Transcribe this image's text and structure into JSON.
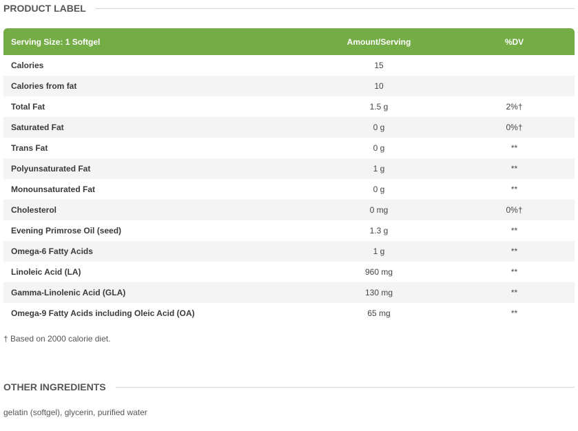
{
  "product_label": {
    "title": "PRODUCT LABEL",
    "headers": {
      "serving": "Serving Size: 1 Softgel",
      "amount": "Amount/Serving",
      "dv": "%DV"
    },
    "rows": [
      {
        "name": "Calories",
        "amount": "15",
        "dv": ""
      },
      {
        "name": "Calories from fat",
        "amount": "10",
        "dv": ""
      },
      {
        "name": "Total Fat",
        "amount": "1.5 g",
        "dv": "2%†"
      },
      {
        "name": "Saturated Fat",
        "amount": "0 g",
        "dv": "0%†"
      },
      {
        "name": "Trans Fat",
        "amount": "0 g",
        "dv": "**"
      },
      {
        "name": "Polyunsaturated Fat",
        "amount": "1 g",
        "dv": "**"
      },
      {
        "name": "Monounsaturated Fat",
        "amount": "0 g",
        "dv": "**"
      },
      {
        "name": "Cholesterol",
        "amount": "0 mg",
        "dv": "0%†"
      },
      {
        "name": "Evening Primrose Oil (seed)",
        "amount": "1.3 g",
        "dv": "**"
      },
      {
        "name": "Omega-6 Fatty Acids",
        "amount": "1 g",
        "dv": "**"
      },
      {
        "name": "Linoleic Acid (LA)",
        "amount": "960 mg",
        "dv": "**"
      },
      {
        "name": "Gamma-Linolenic Acid (GLA)",
        "amount": "130 mg",
        "dv": "**"
      },
      {
        "name": "Omega-9 Fatty Acids including Oleic Acid (OA)",
        "amount": "65 mg",
        "dv": "**"
      }
    ],
    "footnote": "† Based on 2000 calorie diet."
  },
  "other_ingredients": {
    "title": "OTHER INGREDIENTS",
    "text": "gelatin (softgel), glycerin, purified water"
  },
  "colors": {
    "header_green": "#74ac46",
    "stripe_gray": "#f4f4f4"
  }
}
